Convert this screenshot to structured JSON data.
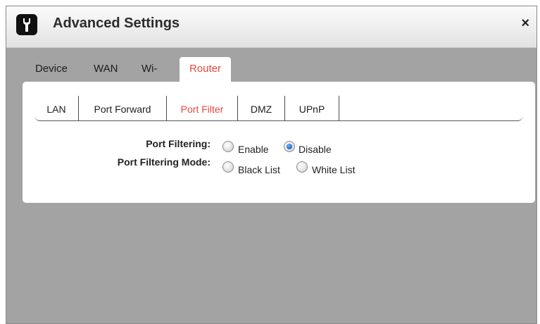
{
  "dialog": {
    "title": "Advanced Settings",
    "close_label": "×"
  },
  "main_tabs": [
    "Device",
    "WAN",
    "Wi-Fi",
    "Router"
  ],
  "main_tab_active": "Router",
  "sub_tabs": [
    "LAN",
    "Port Forward",
    "Port Filter",
    "DMZ",
    "UPnP"
  ],
  "sub_tab_active": "Port Filter",
  "form": {
    "port_filtering": {
      "label": "Port Filtering:",
      "options": [
        "Enable",
        "Disable"
      ],
      "selected": "Disable"
    },
    "port_filtering_mode": {
      "label": "Port Filtering Mode:",
      "options": [
        "Black List",
        "White List"
      ],
      "selected": ""
    }
  },
  "colors": {
    "active_tab": "#e8483d",
    "background": "#a3a3a3",
    "panel": "#ffffff",
    "radio_selected": "#1b63c7"
  },
  "icons": {
    "logo": "wrench-icon",
    "close": "close-icon"
  }
}
